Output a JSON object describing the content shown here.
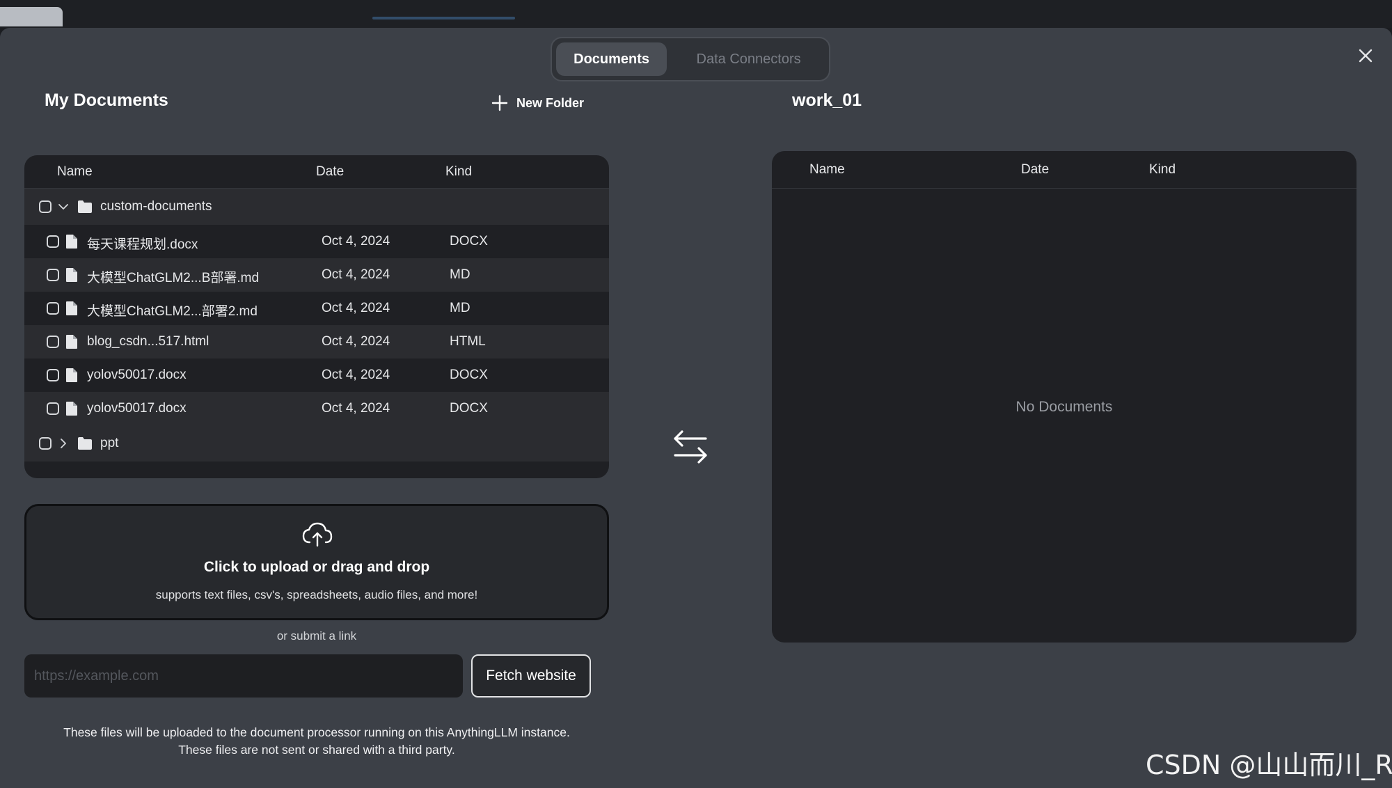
{
  "tabs": [
    {
      "label": "Documents",
      "active": true
    },
    {
      "label": "Data Connectors",
      "active": false
    }
  ],
  "left": {
    "title": "My Documents",
    "new_folder_label": "New Folder",
    "columns": [
      "Name",
      "Date",
      "Kind"
    ],
    "folders": [
      {
        "name": "custom-documents",
        "expanded": true,
        "files": [
          {
            "name": "每天课程规划.docx",
            "date": "Oct 4, 2024",
            "kind": "DOCX"
          },
          {
            "name": "大模型ChatGLM2...B部署.md",
            "date": "Oct 4, 2024",
            "kind": "MD"
          },
          {
            "name": "大模型ChatGLM2...部署2.md",
            "date": "Oct 4, 2024",
            "kind": "MD"
          },
          {
            "name": "blog_csdn...517.html",
            "date": "Oct 4, 2024",
            "kind": "HTML"
          },
          {
            "name": "yolov50017.docx",
            "date": "Oct 4, 2024",
            "kind": "DOCX"
          },
          {
            "name": "yolov50017.docx",
            "date": "Oct 4, 2024",
            "kind": "DOCX"
          }
        ]
      },
      {
        "name": "ppt",
        "expanded": false,
        "files": []
      }
    ],
    "upload": {
      "title": "Click to upload or drag and drop",
      "subtitle": "supports text files, csv's, spreadsheets, audio files, and more!"
    },
    "or_link": "or submit a link",
    "url_placeholder": "https://example.com",
    "fetch_label": "Fetch website",
    "disclaimer_line1": "These files will be uploaded to the document processor running on this AnythingLLM instance.",
    "disclaimer_line2": "These files are not sent or shared with a third party."
  },
  "right": {
    "title": "work_01",
    "columns": [
      "Name",
      "Date",
      "Kind"
    ],
    "empty_message": "No Documents"
  },
  "watermark": "CSDN @山山而川_R",
  "icons": {
    "close": "close-icon",
    "plus": "plus-icon",
    "chevron_down": "chevron-down-icon",
    "chevron_right": "chevron-right-icon",
    "folder": "folder-icon",
    "file": "file-icon",
    "upload": "cloud-upload-icon",
    "swap": "swap-arrows-icon"
  },
  "colors": {
    "modal_bg": "#3c4047",
    "panel_bg": "#1f2024",
    "row_alt_bg": "#2b2c30",
    "muted_text": "#7a7e86"
  }
}
